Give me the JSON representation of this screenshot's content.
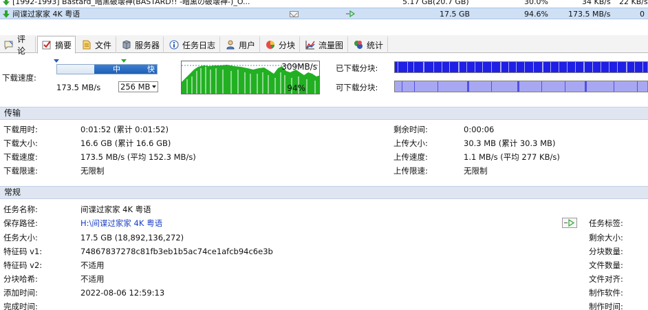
{
  "task_list": {
    "rows": [
      {
        "name": "[1992-1993] Bastard_暗黑破壊神(BASTARD!! -暗黒の破壊神-)_O...",
        "size": "5.17 GB(20.7 GB)",
        "progress": "30.0%",
        "down_speed": "34 KB/s",
        "up_speed": "22 KB/s"
      },
      {
        "name": "间谍过家家 4K 粤语",
        "size": "17.5 GB",
        "progress": "94.6%",
        "down_speed": "173.5 MB/s",
        "up_speed": "0"
      }
    ]
  },
  "tabs": [
    {
      "label": "评论",
      "icon": "comment-icon"
    },
    {
      "label": "摘要",
      "icon": "summary-check-icon",
      "active": true
    },
    {
      "label": "文件",
      "icon": "files-icon"
    },
    {
      "label": "服务器",
      "icon": "server-icon"
    },
    {
      "label": "任务日志",
      "icon": "info-icon"
    },
    {
      "label": "用户",
      "icon": "user-icon"
    },
    {
      "label": "分块",
      "icon": "pie-icon"
    },
    {
      "label": "流量图",
      "icon": "chart-icon"
    },
    {
      "label": "统计",
      "icon": "stats-icon"
    }
  ],
  "speed": {
    "label": "下载速度:",
    "value": "173.5 MB/s",
    "slider_mid": "中",
    "slider_fast": "快",
    "limit_select": "256 MB",
    "graph_max": "309MB/s",
    "graph_percent": "94%",
    "downloaded_label": "已下载分块:",
    "available_label": "可下载分块:"
  },
  "transfer": {
    "title": "传输",
    "left": [
      {
        "label": "下载用时:",
        "value": "0:01:52 (累计 0:01:52)"
      },
      {
        "label": "下载大小:",
        "value": "16.6 GB (累计 16.6 GB)"
      },
      {
        "label": "下载速度:",
        "value": "173.5 MB/s (平均 152.3 MB/s)"
      },
      {
        "label": "下载限速:",
        "value": "无限制"
      }
    ],
    "right": [
      {
        "label": "剩余时间:",
        "value": "0:00:06"
      },
      {
        "label": "上传大小:",
        "value": "30.3 MB (累计 30.3 MB)"
      },
      {
        "label": "上传速度:",
        "value": "1.1 MB/s (平均 277 KB/s)"
      },
      {
        "label": "上传限速:",
        "value": "无限制"
      }
    ]
  },
  "general": {
    "title": "常规",
    "left": [
      {
        "label": "任务名称:",
        "value": "间谍过家家 4K 粤语"
      },
      {
        "label": "保存路径:",
        "value": "H:\\间谍过家家 4K 粤语"
      },
      {
        "label": "任务大小:",
        "value": "17.5 GB (18,892,136,272)"
      },
      {
        "label": "特征码 v1:",
        "value": "74867837278c81fb3eb1b5ac74ce1afcb94c6e3b"
      },
      {
        "label": "特征码 v2:",
        "value": "不适用"
      },
      {
        "label": "分块哈希:",
        "value": "不适用"
      },
      {
        "label": "添加时间:",
        "value": "2022-08-06 12:59:13"
      },
      {
        "label": "完成时间:",
        "value": ""
      }
    ],
    "right": [
      {
        "label": "任务标签:"
      },
      {
        "label": "剩余大小:"
      },
      {
        "label": "分块数量:"
      },
      {
        "label": "文件数量:"
      },
      {
        "label": "文件对齐:"
      },
      {
        "label": "制作软件:"
      },
      {
        "label": "制作时间:"
      }
    ]
  },
  "colors": {
    "selected_row": "#cfe0f5",
    "graph_fill": "#22b022",
    "downloaded_bar": "#1f1fe6",
    "available_bar": "#a8a8f2",
    "section_header": "#dfe6f2",
    "link": "#1a3fc7"
  }
}
